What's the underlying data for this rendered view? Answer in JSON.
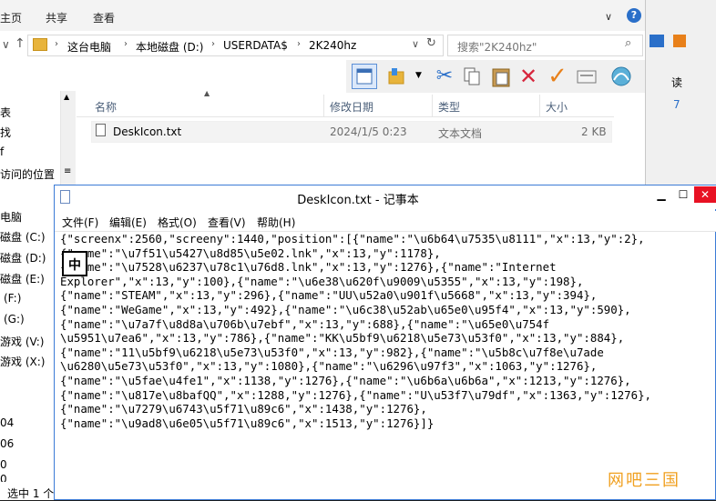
{
  "explorer": {
    "ribbon_tabs": [
      "主页",
      "共享",
      "查看"
    ],
    "address": [
      "这台电脑",
      "本地磁盘 (D:)",
      "USERDATA$",
      "2K240hz"
    ],
    "search_placeholder": "搜索\"2K240hz\"",
    "nav_items": [
      "表",
      "找",
      "f",
      "访问的位置",
      "电脑",
      "磁盘 (C:)",
      "磁盘 (D:)",
      "磁盘 (E:)",
      "(F:)",
      "(G:)",
      "游戏 (V:)",
      "游戏 (X:)",
      "04",
      "06",
      "0",
      "0"
    ],
    "columns": [
      "名称",
      "修改日期",
      "类型",
      "大小"
    ],
    "file": {
      "name": "DeskIcon.txt",
      "date": "2024/1/5 0:23",
      "type": "文本文档",
      "size": "2 KB"
    },
    "status": "选中 1 个"
  },
  "rightwin": {
    "label": "读",
    "digit": "7"
  },
  "notepad": {
    "title": "DeskIcon.txt - 记事本",
    "menus": [
      "文件(F)",
      "编辑(E)",
      "格式(O)",
      "查看(V)",
      "帮助(H)"
    ],
    "ime": "中",
    "content": "{\"screenx\":2560,\"screeny\":1440,\"position\":[{\"name\":\"\\u6b64\\u7535\\u8111\",\"x\":13,\"y\":2},\n{\"name\":\"\\u7f51\\u5427\\u8d85\\u5e02.lnk\",\"x\":13,\"y\":1178},\n{\"name\":\"\\u7528\\u6237\\u78c1\\u76d8.lnk\",\"x\":13,\"y\":1276},{\"name\":\"Internet\nExplorer\",\"x\":13,\"y\":100},{\"name\":\"\\u6e38\\u620f\\u9009\\u5355\",\"x\":13,\"y\":198},\n{\"name\":\"STEAM\",\"x\":13,\"y\":296},{\"name\":\"UU\\u52a0\\u901f\\u5668\",\"x\":13,\"y\":394},\n{\"name\":\"WeGame\",\"x\":13,\"y\":492},{\"name\":\"\\u6c38\\u52ab\\u65e0\\u95f4\",\"x\":13,\"y\":590},\n{\"name\":\"\\u7a7f\\u8d8a\\u706b\\u7ebf\",\"x\":13,\"y\":688},{\"name\":\"\\u65e0\\u754f\n\\u5951\\u7ea6\",\"x\":13,\"y\":786},{\"name\":\"KK\\u5bf9\\u6218\\u5e73\\u53f0\",\"x\":13,\"y\":884},\n{\"name\":\"11\\u5bf9\\u6218\\u5e73\\u53f0\",\"x\":13,\"y\":982},{\"name\":\"\\u5b8c\\u7f8e\\u7ade\n\\u6280\\u5e73\\u53f0\",\"x\":13,\"y\":1080},{\"name\":\"\\u6296\\u97f3\",\"x\":1063,\"y\":1276},\n{\"name\":\"\\u5fae\\u4fe1\",\"x\":1138,\"y\":1276},{\"name\":\"\\u6b6a\\u6b6a\",\"x\":1213,\"y\":1276},\n{\"name\":\"\\u817e\\u8bafQQ\",\"x\":1288,\"y\":1276},{\"name\":\"U\\u53f7\\u79df\",\"x\":1363,\"y\":1276},\n{\"name\":\"\\u7279\\u6743\\u5f71\\u89c6\",\"x\":1438,\"y\":1276},\n{\"name\":\"\\u9ad8\\u6e05\\u5f71\\u89c6\",\"x\":1513,\"y\":1276}]}"
  },
  "watermark": "网吧三国",
  "colors": {
    "accent": "#3b7bd6",
    "close": "#e81123",
    "header_text": "#4c607a",
    "watermark": "#f0a020"
  }
}
